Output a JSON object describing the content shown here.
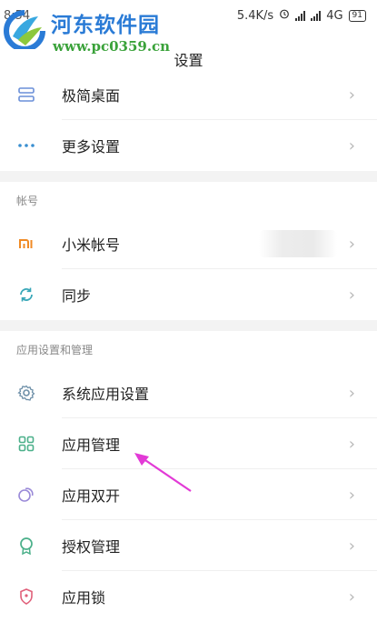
{
  "status_bar": {
    "time": "8:54",
    "speed": "5.4K/s",
    "network": "4G",
    "battery": "91"
  },
  "watermark": {
    "title": "河东软件园",
    "url": "www.pc0359.cn"
  },
  "header": {
    "title": "设置"
  },
  "groups": [
    {
      "items": [
        {
          "label": "极简桌面",
          "icon": "minimal-desktop-icon"
        },
        {
          "label": "更多设置",
          "icon": "more-dots-icon"
        }
      ]
    },
    {
      "header": "帐号",
      "items": [
        {
          "label": "小米帐号",
          "icon": "mi-logo-icon"
        },
        {
          "label": "同步",
          "icon": "sync-icon"
        }
      ]
    },
    {
      "header": "应用设置和管理",
      "items": [
        {
          "label": "系统应用设置",
          "icon": "gear-icon"
        },
        {
          "label": "应用管理",
          "icon": "app-grid-icon"
        },
        {
          "label": "应用双开",
          "icon": "dual-app-icon"
        },
        {
          "label": "授权管理",
          "icon": "permission-badge-icon"
        },
        {
          "label": "应用锁",
          "icon": "app-lock-icon"
        }
      ]
    }
  ],
  "colors": {
    "watermark_blue": "#2a7bd6",
    "watermark_green": "#3aa23a",
    "icon_accent": "#5aa9a0",
    "arrow": "#e23ad6"
  }
}
